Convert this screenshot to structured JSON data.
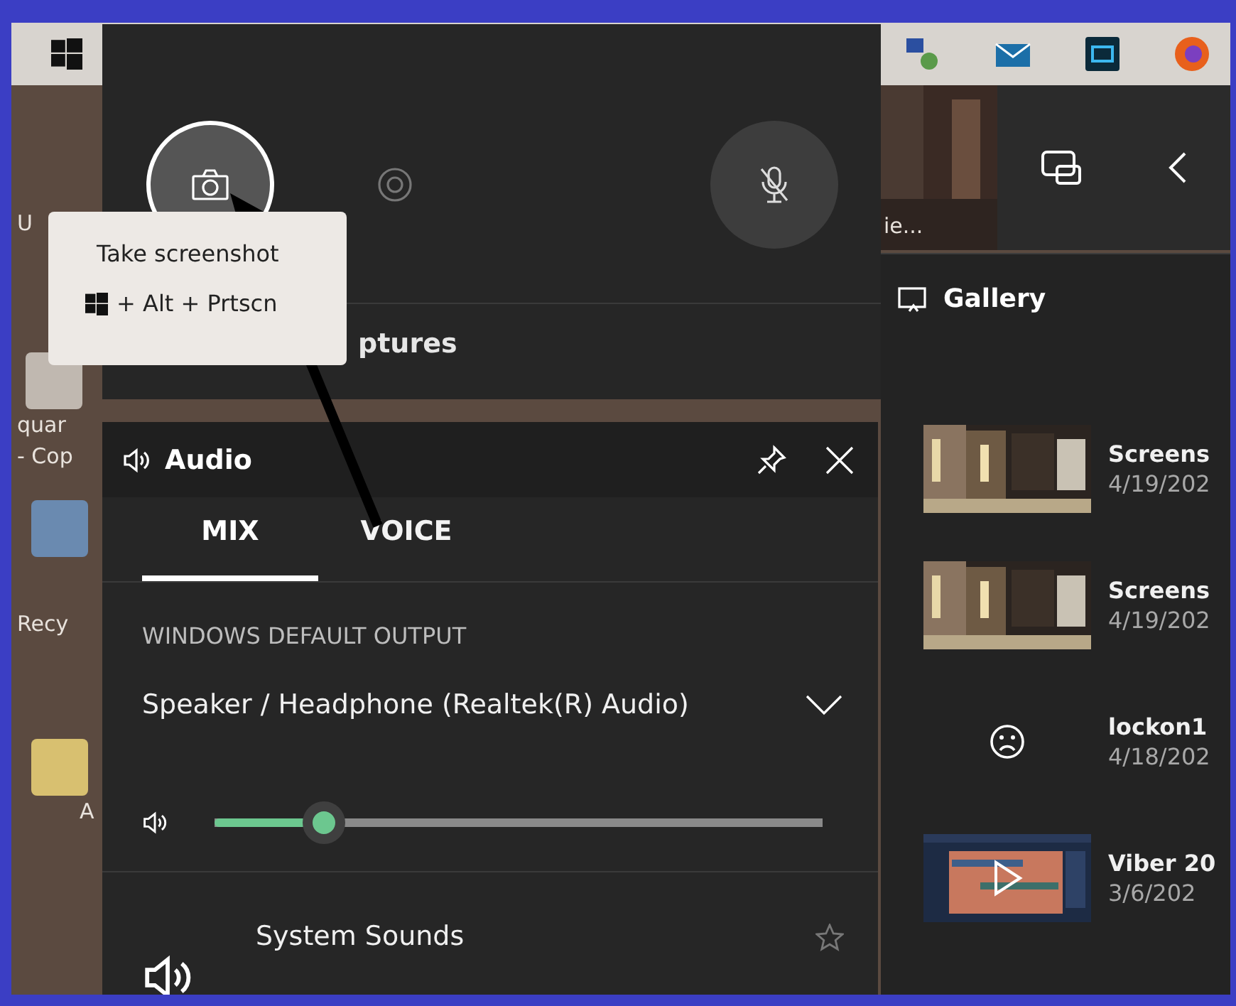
{
  "desktop": {
    "icon_labels": [
      "U",
      "quar",
      "- Cop",
      "Recy",
      "A"
    ]
  },
  "capture_widget": {
    "buttons": [
      {
        "kind": "screenshot",
        "selected": true
      },
      {
        "kind": "record",
        "selected": false
      },
      {
        "kind": "mic",
        "selected": false
      }
    ],
    "heading": "ptures"
  },
  "tooltip": {
    "title": "Take screenshot",
    "shortcut": "+ Alt + Prtscn"
  },
  "audio": {
    "title": "Audio",
    "tabs": [
      {
        "label": "MIX",
        "selected": true
      },
      {
        "label": "VOICE",
        "selected": false
      }
    ],
    "section": "WINDOWS DEFAULT OUTPUT",
    "device": "Speaker / Headphone (Realtek(R) Audio)",
    "volume": {
      "level": 0.18
    },
    "apps": [
      {
        "name": "System Sounds",
        "favorite": false
      }
    ]
  },
  "side_window": {
    "caption": "ie..."
  },
  "gallery": {
    "title": "Gallery",
    "items": [
      {
        "name": "Screens",
        "date": "4/19/202"
      },
      {
        "name": "Screens",
        "date": "4/19/202"
      },
      {
        "kind": "broken",
        "name": "lockon1",
        "date": "4/18/202"
      },
      {
        "kind": "video",
        "name": "Viber 20",
        "date": "3/6/202"
      }
    ]
  }
}
